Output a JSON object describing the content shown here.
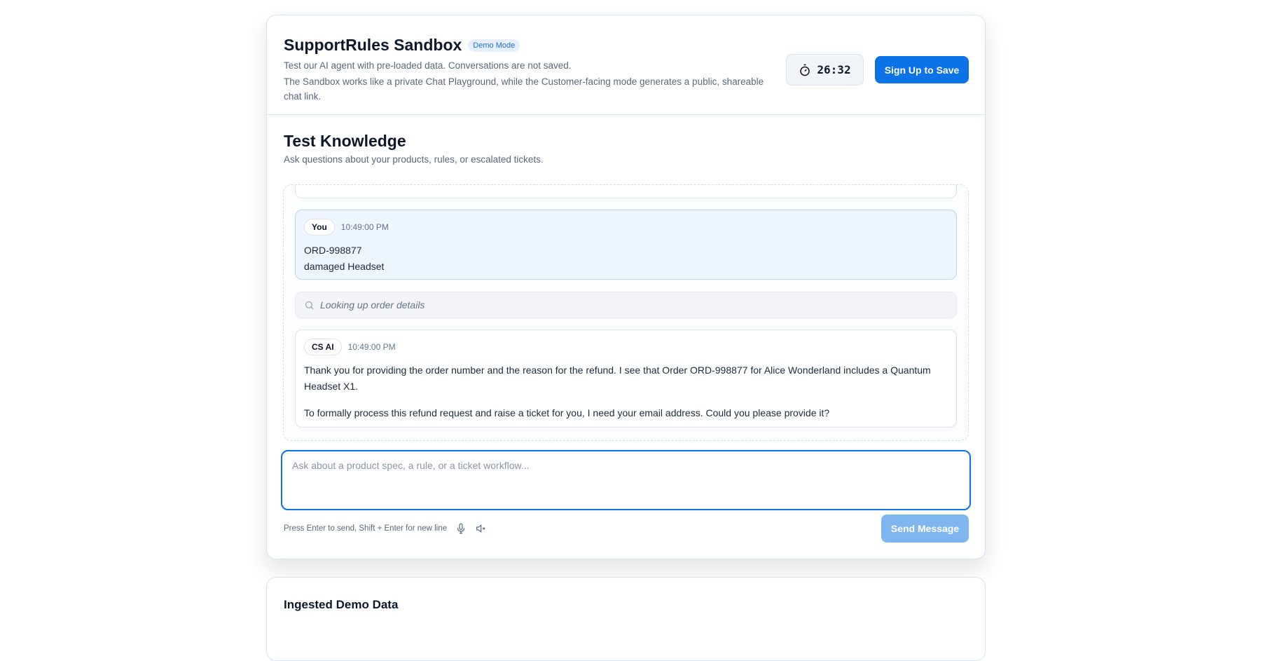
{
  "header": {
    "title": "SupportRules Sandbox",
    "badge": "Demo Mode",
    "subtitle": "Test our AI agent with pre-loaded data. Conversations are not saved.",
    "description": "The Sandbox works like a private Chat Playground, while the Customer-facing mode generates a public, shareable chat link.",
    "timer": "26:32",
    "signup_label": "Sign Up to Save"
  },
  "knowledge": {
    "title": "Test Knowledge",
    "subtitle": "Ask questions about your products, rules, or escalated tickets."
  },
  "messages": [
    {
      "sender": "You",
      "time": "10:49:00 PM",
      "lines": [
        "ORD-998877",
        "damaged Headset"
      ]
    },
    {
      "sender": "CS AI",
      "time": "10:49:00 PM",
      "lines": [
        "Thank you for providing the order number and the reason for the refund. I see that Order ORD-998877 for Alice Wonderland includes a Quantum Headset X1.",
        "To formally process this refund request and raise a ticket for you, I need your email address. Could you please provide it?"
      ]
    }
  ],
  "tool_status": "Looking up order details",
  "composer": {
    "placeholder": "Ask about a product spec, a rule, or a ticket workflow...",
    "value": "",
    "hint": "Press Enter to send, Shift + Enter for new line",
    "send_label": "Send Message"
  },
  "data_section": {
    "title": "Ingested Demo Data"
  }
}
